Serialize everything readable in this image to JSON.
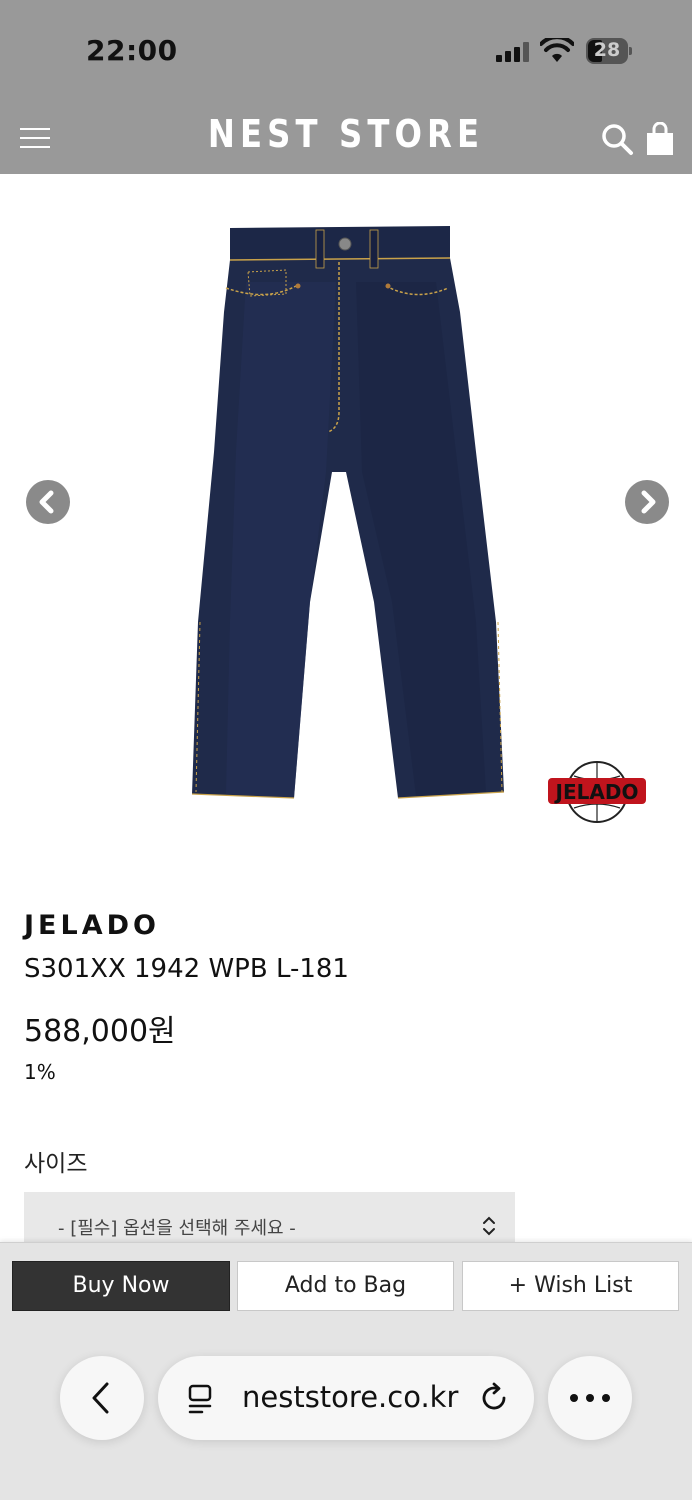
{
  "status_bar": {
    "time": "22:00",
    "battery": "28"
  },
  "header": {
    "title": "NEST STORE"
  },
  "product": {
    "brand": "JELADO",
    "name": "S301XX 1942 WPB L-181",
    "price": "588,000원",
    "discount": "1%",
    "image_logo_text": "JELADO"
  },
  "options": {
    "label": "사이즈",
    "placeholder": "- [필수] 옵션을 선택해 주세요 -"
  },
  "actions": {
    "buy_now": "Buy Now",
    "add_to_bag": "Add to Bag",
    "wish_list": "+ Wish List"
  },
  "browser": {
    "url": "neststore.co.kr"
  },
  "colors": {
    "header_bg": "#999999",
    "denim": "#1f2a4a",
    "stitch": "#c9a24a",
    "buy_bg": "#333333"
  }
}
